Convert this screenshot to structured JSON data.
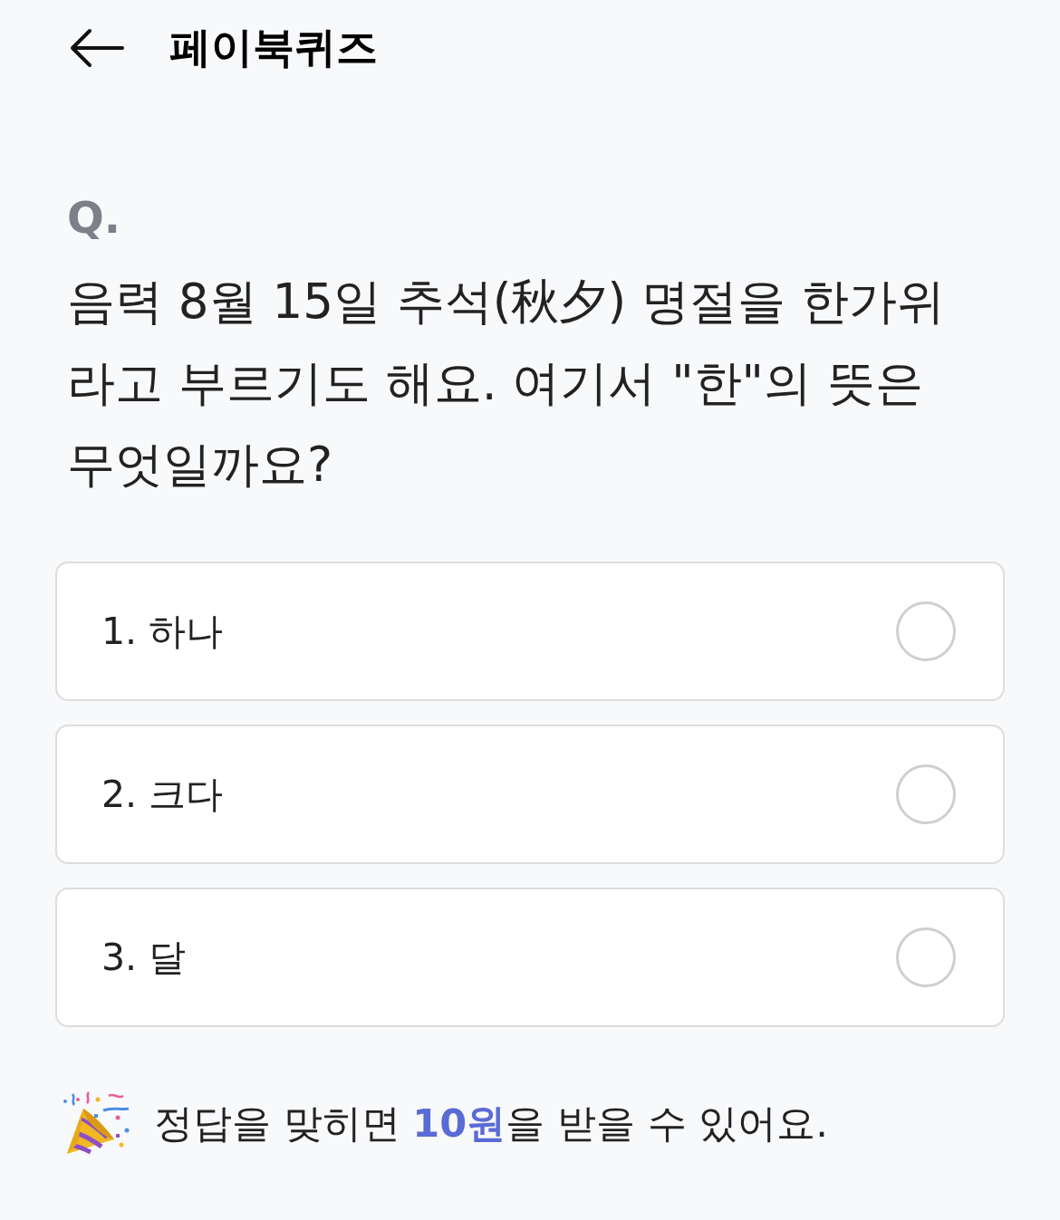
{
  "header": {
    "title": "페이북퀴즈"
  },
  "quiz": {
    "label": "Q.",
    "question": "음력 8월 15일 추석(秋夕) 명절을 한가위라고 부르기도 해요. 여기서 \"한\"의 뜻은 무엇일까요?",
    "options": [
      {
        "text": "1. 하나",
        "selected": false
      },
      {
        "text": "2. 크다",
        "selected": false
      },
      {
        "text": "3. 달",
        "selected": false
      }
    ]
  },
  "reward": {
    "text": "정답을 맞히면 **10원**을 받을 수 있어요."
  }
}
